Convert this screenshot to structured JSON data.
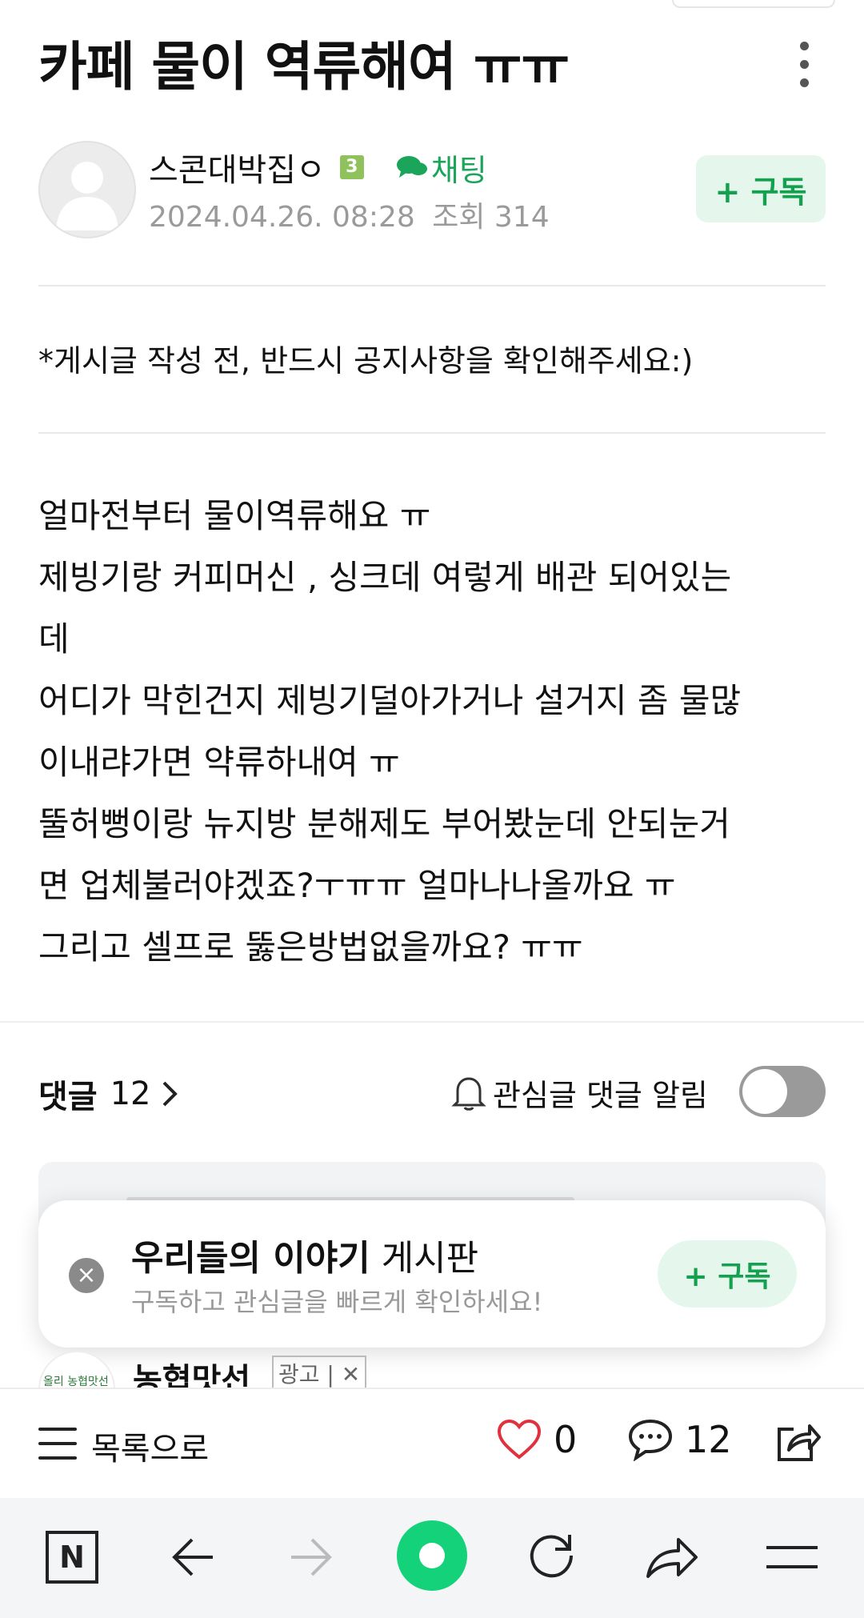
{
  "post": {
    "title": "카페 물이 역류해여 ㅠㅠ",
    "author": "스콘대박집ㅇ",
    "level": "3",
    "chat_label": "채팅",
    "date": "2024.04.26. 08:28",
    "views_label": "조회 314",
    "subscribe_label": "+ 구독",
    "notice": "*게시글 작성 전, 반드시 공지사항을 확인해주세요:)",
    "body_lines": [
      "얼마전부터 물이역류해요 ㅠ",
      "제빙기랑 커피머신 , 싱크데 여렇게 배관 되어있는",
      "데",
      "어디가 막힌건지 제빙기덜아가거나 설거지 좀 물많",
      "이내랴가면 약류하내여 ㅠ",
      "뚤허뻥이랑 뉴지방 분해제도 부어봤눈데 안되눈거",
      "면 업체불러야겠죠?ㅜㅠㅠ 얼마나나올까요 ㅠ",
      "그리고 셀프로 뚫은방법없을까요? ㅠㅠ"
    ]
  },
  "comments": {
    "label": "댓글",
    "count": "12",
    "alarm_label": "관심글 댓글 알림",
    "alarm_on": false
  },
  "popup": {
    "board_name": "우리들의 이야기",
    "board_suffix": "게시판",
    "subtitle": "구독하고 관심글을 빠르게 확인하세요!",
    "subscribe_label": "+ 구독"
  },
  "ad": {
    "name": "농협맛선",
    "badge": "광고 | ✕",
    "logo_text": "올리 농협맛선"
  },
  "bottom_bar": {
    "list_label": "목록으로",
    "likes": "0",
    "comments": "12"
  },
  "browser_bar": {
    "home_label": "N"
  },
  "colors": {
    "accent_green": "#14a14f",
    "subscribe_bg": "#e5f7ec",
    "like_red": "#e0323e",
    "browser_green": "#14d27a"
  }
}
